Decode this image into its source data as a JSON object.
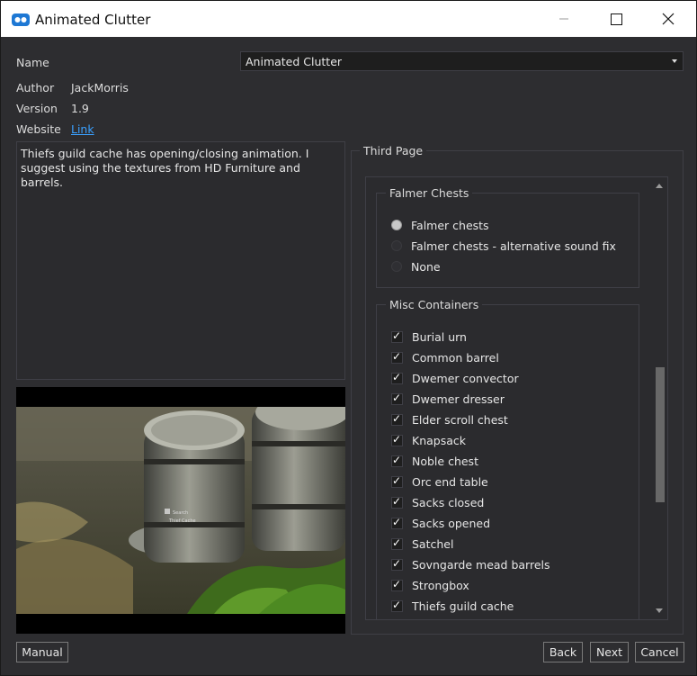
{
  "window": {
    "title": "Animated Clutter",
    "app_icon": "mo-logo-icon",
    "controls": [
      "minimize-icon",
      "maximize-icon",
      "close-icon"
    ]
  },
  "info": {
    "name_label": "Name",
    "name_value": "Animated Clutter",
    "author_label": "Author",
    "author_value": "JackMorris",
    "version_label": "Version",
    "version_value": "1.9",
    "website_label": "Website",
    "website_link": "Link"
  },
  "description": "Thiefs guild cache has opening/closing animation. I suggest using the textures from HD Furniture and barrels.",
  "preview": {
    "prompt_key": "E",
    "prompt_action": "Search",
    "prompt_target": "Thief Cache"
  },
  "page": {
    "title": "Third Page",
    "falmer": {
      "title": "Falmer Chests",
      "options": [
        {
          "label": "Falmer chests",
          "selected": true
        },
        {
          "label": "Falmer chests - alternative sound fix",
          "selected": false
        },
        {
          "label": "None",
          "selected": false
        }
      ]
    },
    "misc": {
      "title": "Misc Containers",
      "items": [
        {
          "label": "Burial urn",
          "checked": true
        },
        {
          "label": "Common barrel",
          "checked": true
        },
        {
          "label": "Dwemer convector",
          "checked": true
        },
        {
          "label": "Dwemer dresser",
          "checked": true
        },
        {
          "label": "Elder scroll chest",
          "checked": true
        },
        {
          "label": "Knapsack",
          "checked": true
        },
        {
          "label": "Noble chest",
          "checked": true
        },
        {
          "label": "Orc end table",
          "checked": true
        },
        {
          "label": "Sacks closed",
          "checked": true
        },
        {
          "label": "Sacks opened",
          "checked": true
        },
        {
          "label": "Satchel",
          "checked": true
        },
        {
          "label": "Sovngarde mead barrels",
          "checked": true
        },
        {
          "label": "Strongbox",
          "checked": true
        },
        {
          "label": "Thiefs guild cache",
          "checked": true
        }
      ]
    }
  },
  "buttons": {
    "manual": "Manual",
    "back": "Back",
    "next": "Next",
    "cancel": "Cancel"
  },
  "colors": {
    "background": "#2d2d30",
    "link": "#3aa0ff",
    "titlebar": "#ffffff"
  }
}
